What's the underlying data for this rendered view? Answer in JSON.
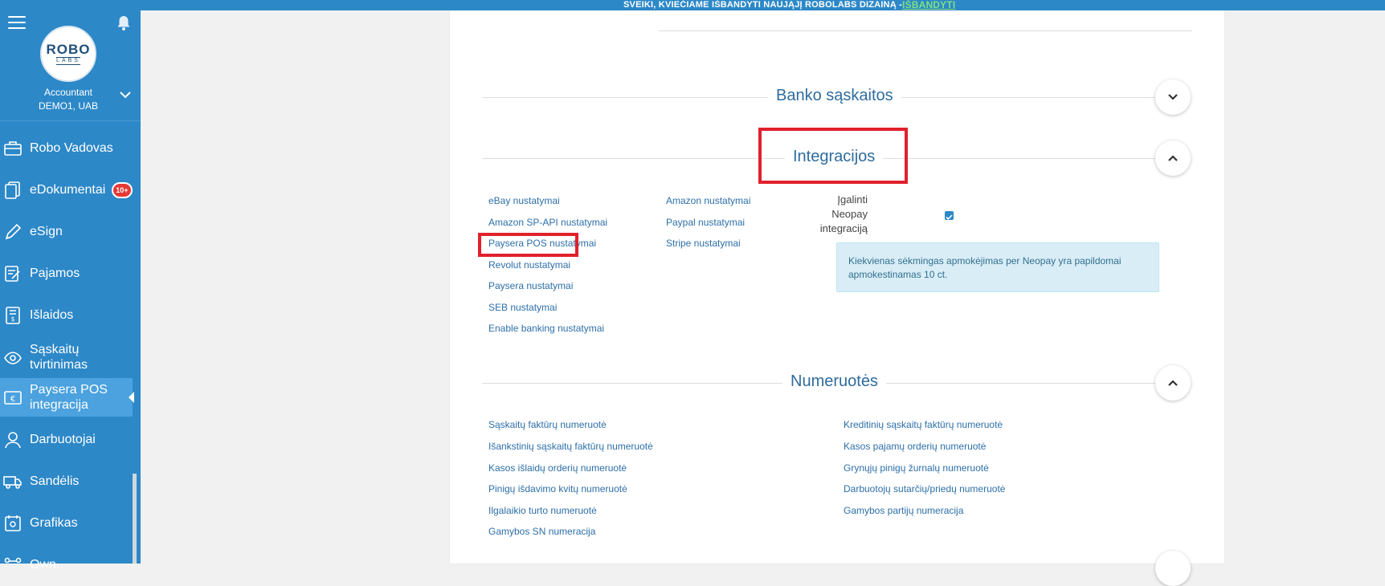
{
  "topbar": {
    "text": "SVEIKI, KVIEČIAME IŠBANDYTI NAUJĄJĮ ROBOLABS DIZAINĄ - ",
    "link": "IŠBANDYTI"
  },
  "logo": {
    "line1": "ROBO",
    "line2": "LABS"
  },
  "account": {
    "role": "Accountant",
    "company": "DEMO1, UAB"
  },
  "sidebar": {
    "items": [
      {
        "label": "Robo Vadovas",
        "icon": "briefcase-icon"
      },
      {
        "label": "eDokumentai",
        "icon": "documents-icon",
        "badge": "10+"
      },
      {
        "label": "eSign",
        "icon": "pen-icon"
      },
      {
        "label": "Pajamos",
        "icon": "income-icon"
      },
      {
        "label": "Išlaidos",
        "icon": "expenses-icon"
      },
      {
        "label": "Sąskaitų tvirtinimas",
        "icon": "eye-icon"
      },
      {
        "label": "Paysera POS integracija",
        "icon": "euro-card-icon",
        "active": true
      },
      {
        "label": "Darbuotojai",
        "icon": "user-icon"
      },
      {
        "label": "Sandėlis",
        "icon": "truck-icon"
      },
      {
        "label": "Grafikas",
        "icon": "schedule-icon"
      },
      {
        "label": "Own..",
        "icon": "network-icon"
      }
    ]
  },
  "sections": {
    "bank": {
      "title": "Banko sąskaitos"
    },
    "integrations": {
      "title": "Integracijos",
      "col1": [
        "eBay nustatymai",
        "Amazon SP-API nustatymai",
        "Paysera POS nustatymai",
        "Revolut nustatymai",
        "Paysera nustatymai",
        "SEB nustatymai",
        "Enable banking nustatymai"
      ],
      "col2": [
        "Amazon nustatymai",
        "Paypal nustatymai",
        "Stripe nustatymai"
      ],
      "neopay_label": [
        "Įgalinti",
        "Neopay",
        "integraciją"
      ],
      "info": "Kiekvienas sėkmingas apmokėjimas per Neopay yra papildomai apmokestinamas 10 ct."
    },
    "numbering": {
      "title": "Numeruotės",
      "col1": [
        "Sąskaitų faktūrų numeruotė",
        "Išankstinių sąskaitų faktūrų numeruotė",
        "Kasos išlaidų orderių numeruotė",
        "Pinigų išdavimo kvitų numeruotė",
        "Ilgalaikio turto numeruotė",
        "Gamybos SN numeracija"
      ],
      "col2": [
        "Kreditinių sąskaitų faktūrų numeruotė",
        "Kasos pajamų orderių numeruotė",
        "Grynųjų pinigų žurnalų numeruotė",
        "Darbuotojų sutarčių/priedų numeruotė",
        "Gamybos partijų numeracija"
      ]
    }
  },
  "colors": {
    "sidebar": "#2d88c8",
    "accent": "#2d6fa8",
    "highlight": "#e0212c"
  }
}
